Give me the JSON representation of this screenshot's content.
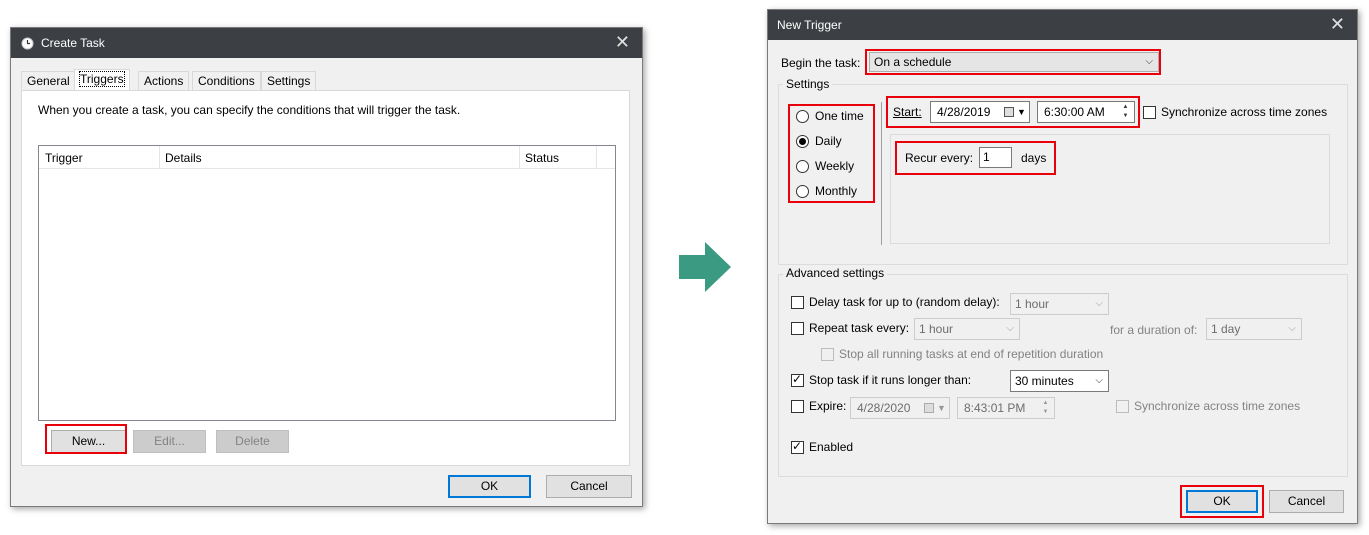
{
  "create_task": {
    "title": "Create Task",
    "close_glyph": "✕",
    "tabs": [
      "General",
      "Triggers",
      "Actions",
      "Conditions",
      "Settings"
    ],
    "description": "When you create a task, you can specify the conditions that will trigger the task.",
    "columns": [
      "Trigger",
      "Details",
      "Status"
    ],
    "buttons": {
      "new": "New...",
      "edit": "Edit...",
      "delete": "Delete",
      "ok": "OK",
      "cancel": "Cancel"
    }
  },
  "arrow": {
    "color": "#3a9a82"
  },
  "new_trigger": {
    "title": "New Trigger",
    "close_glyph": "✕",
    "begin_label": "Begin the task:",
    "begin_value": "On a schedule",
    "settings_label": "Settings",
    "radios": [
      "One time",
      "Daily",
      "Weekly",
      "Monthly"
    ],
    "selected_radio": "Daily",
    "start_label": "Start:",
    "start_date": "4/28/2019",
    "start_time": "6:30:00 AM",
    "sync_label": "Synchronize across time zones",
    "recur_label": "Recur every:",
    "recur_value": "1",
    "recur_unit": "days",
    "advanced_label": "Advanced settings",
    "delay_label": "Delay task for up to (random delay):",
    "delay_value": "1 hour",
    "repeat_label": "Repeat task every:",
    "repeat_value": "1 hour",
    "duration_label": "for a duration of:",
    "duration_value": "1 day",
    "stop_all_label": "Stop all running tasks at end of repetition duration",
    "stop_longer_label": "Stop task if it runs longer than:",
    "stop_longer_value": "30 minutes",
    "expire_label": "Expire:",
    "expire_date": "4/28/2020",
    "expire_time": "8:43:01 PM",
    "expire_sync_label": "Synchronize across time zones",
    "enabled_label": "Enabled",
    "ok": "OK",
    "cancel": "Cancel"
  },
  "colors": {
    "highlight": "#e8000b",
    "titlebar": "#3c4045",
    "focus": "#0078d7"
  }
}
